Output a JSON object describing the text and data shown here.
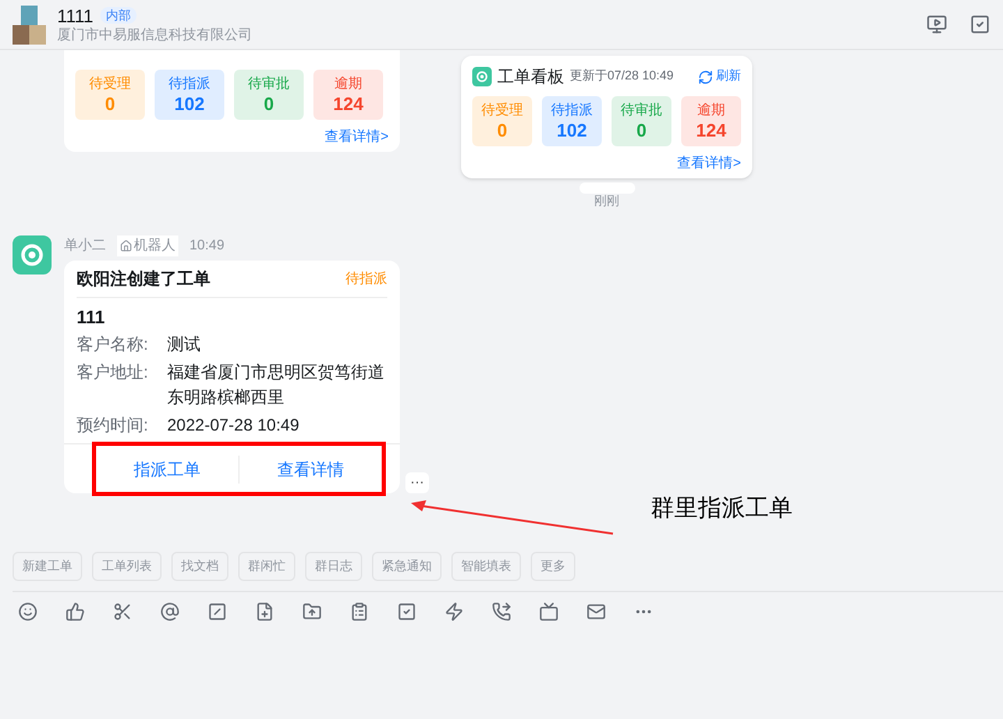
{
  "header": {
    "title": "1111",
    "badge": "内部",
    "subtitle": "厦门市中易服信息科技有限公司"
  },
  "board_partial": {
    "stats": [
      {
        "label": "待受理",
        "value": "0",
        "color": "#ff8c00"
      },
      {
        "label": "待指派",
        "value": "102",
        "color": "#1677ff"
      },
      {
        "label": "待审批",
        "value": "0",
        "color": "#18a84a"
      },
      {
        "label": "逾期",
        "value": "124",
        "color": "#f5452d"
      }
    ],
    "link": "查看详情>"
  },
  "board": {
    "title": "工单看板",
    "updated": "更新于07/28 10:49",
    "refresh": "刷新",
    "stats": [
      {
        "label": "待受理",
        "value": "0",
        "color": "#ff8c00"
      },
      {
        "label": "待指派",
        "value": "102",
        "color": "#1677ff"
      },
      {
        "label": "待审批",
        "value": "0",
        "color": "#18a84a"
      },
      {
        "label": "逾期",
        "value": "124",
        "color": "#f5452d"
      }
    ],
    "link": "查看详情>"
  },
  "time_divider": "刚刚",
  "bot_message": {
    "sender": "单小二",
    "tag": "机器人",
    "time": "10:49",
    "card": {
      "title": "欧阳注创建了工单",
      "status": "待指派",
      "number": "111",
      "fields": [
        {
          "label": "客户名称:",
          "value": "测试"
        },
        {
          "label": "客户地址:",
          "value": "福建省厦门市思明区贺笃街道东明路槟榔西里"
        },
        {
          "label": "预约时间:",
          "value": "2022-07-28 10:49"
        }
      ],
      "actions": [
        "指派工单",
        "查看详情"
      ]
    },
    "more": "···"
  },
  "annotation": "群里指派工单",
  "quick_actions": [
    "新建工单",
    "工单列表",
    "找文档",
    "群闲忙",
    "群日志",
    "紧急通知",
    "智能填表",
    "更多"
  ]
}
